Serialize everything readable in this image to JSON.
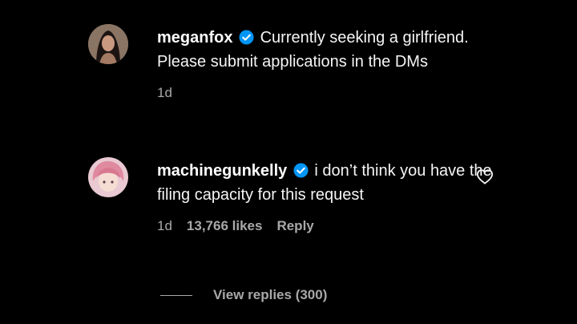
{
  "comments": [
    {
      "username": "meganfox",
      "text": "Currently seeking a girlfriend. Please submit applications in the DMs",
      "time": "1d"
    },
    {
      "username": "machinegunkelly",
      "text": "i don’t think you have the filing capacity for this request",
      "time": "1d",
      "likes": "13,766 likes",
      "reply_label": "Reply"
    }
  ],
  "view_replies": "View replies (300)",
  "icons": {
    "verified": "verified-badge-icon",
    "heart": "heart-outline-icon"
  },
  "colors": {
    "background": "#000000",
    "text": "#f5f5f5",
    "muted": "#a8a8a8",
    "verified": "#0095f6"
  }
}
